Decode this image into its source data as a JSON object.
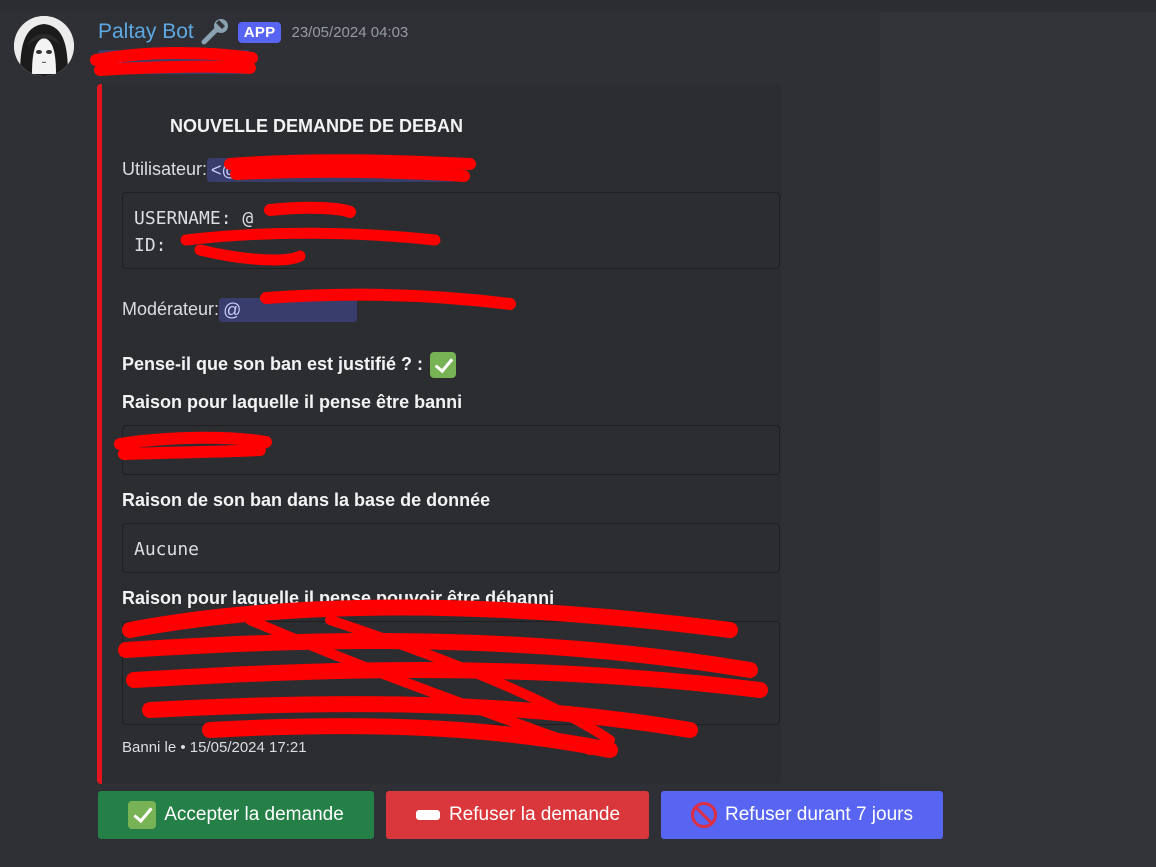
{
  "message": {
    "author": "Paltay Bot",
    "author_icon": "wrench-icon",
    "badge": "APP",
    "timestamp": "23/05/2024 04:03",
    "mention": "@"
  },
  "embed": {
    "accent_color": "#e3141e",
    "title": "NOUVELLE DEMANDE DE DEBAN",
    "user_label": "Utilisateur:",
    "user_mention": "<@",
    "user_code": {
      "username_line": "USERNAME: @",
      "id_line": "ID:"
    },
    "moderator_label": "Modérateur:",
    "moderator_mention": "@",
    "justified_question": "Pense-il que son ban est justifié ? :",
    "justified_icon": "check-mark-icon",
    "reason_banned_label": "Raison pour laquelle il pense être banni",
    "reason_banned_value": "",
    "db_reason_label": "Raison de son ban dans la base de donnée",
    "db_reason_value": "Aucune",
    "reason_unban_label": "Raison pour laquelle il pense pouvoir être débanni",
    "reason_unban_value": "",
    "footer": "Banni le • 15/05/2024 17:21"
  },
  "buttons": {
    "accept": {
      "label": "Accepter la demande",
      "icon": "check-mark-icon",
      "color": "#248046"
    },
    "refuse": {
      "label": "Refuser la demande",
      "icon": "minus-icon",
      "color": "#da373c"
    },
    "refuse7": {
      "label": "Refuser durant 7 jours",
      "icon": "no-entry-icon",
      "color": "#5865f2"
    }
  }
}
